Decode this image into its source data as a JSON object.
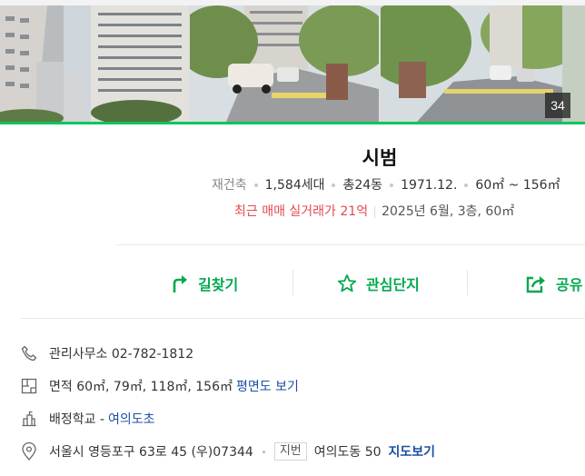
{
  "photos": {
    "count": "34"
  },
  "complex": {
    "name": "시범",
    "summary": {
      "status": "재건축",
      "households": "1,584세대",
      "floors": "총24동",
      "built": "1971.12.",
      "area_range": "60㎡ ~ 156㎡"
    },
    "deal": {
      "latest": "최근 매매 실거래가 21억",
      "detail": "2025년 6월, 3층, 60㎡"
    }
  },
  "actions": {
    "route": "길찾기",
    "favorite": "관심단지",
    "share": "공유"
  },
  "info": {
    "phone_label": "관리사무소 02-782-1812",
    "area_label": "면적 60㎡, 79㎡, 118㎡, 156㎡",
    "floorplan_link": "평면도 보기",
    "school_label": "배정학교 -",
    "school_link": "여의도초",
    "address": "서울시 영등포구 63로 45 (우)07344",
    "lot_badge": "지번",
    "lot_address": "여의도동 50",
    "map_link": "지도보기"
  },
  "colors": {
    "accent": "#03c75a",
    "deal_red": "#e5484d",
    "link_blue": "#1a4fa3"
  },
  "icons": [
    "route-icon",
    "star-icon",
    "share-icon",
    "phone-icon",
    "floorplan-icon",
    "school-icon",
    "location-pin-icon"
  ]
}
